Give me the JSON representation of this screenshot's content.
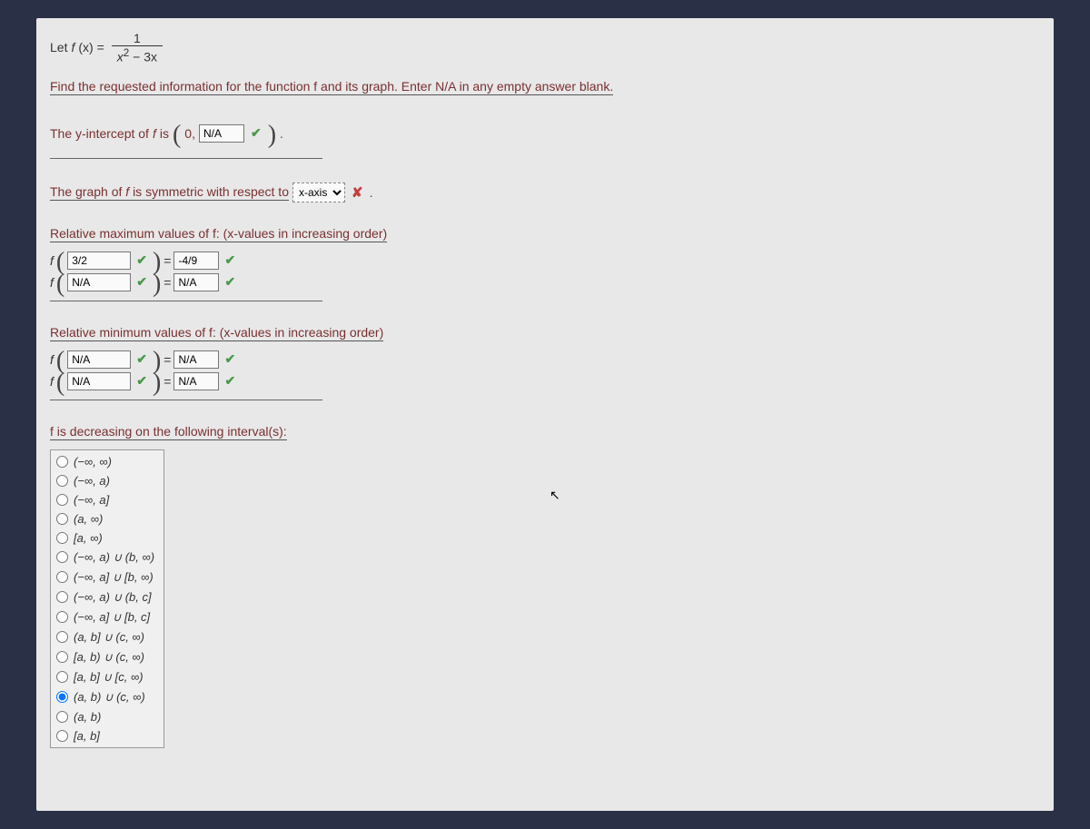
{
  "func": {
    "prefix": "Let ",
    "fname": "f",
    "arg": " (x) = ",
    "num": "1",
    "den_a": "x",
    "den_b": " − 3x",
    "den_sup": "2"
  },
  "instruction": "Find the requested information for the function f and its graph. Enter N/A in any empty answer blank.",
  "yint": {
    "pre": "The y-intercept of ",
    "f": "f",
    "mid": " is ",
    "zero": "0, ",
    "value": "N/A",
    "period": "."
  },
  "sym": {
    "pre": "The graph of ",
    "f": "f",
    "mid": " is symmetric with respect to ",
    "selected": "x-axis",
    "dot": "."
  },
  "relmax": {
    "heading": "Relative maximum values of f: (x-values in increasing order)",
    "r1_x": "3/2",
    "r1_y": "-4/9",
    "r2_x": "N/A",
    "r2_y": "N/A"
  },
  "relmin": {
    "heading": "Relative minimum values of f: (x-values in increasing order)",
    "r1_x": "N/A",
    "r1_y": "N/A",
    "r2_x": "N/A",
    "r2_y": "N/A"
  },
  "decreasing": {
    "heading": "f is decreasing on the following interval(s):",
    "options": [
      "(−∞, ∞)",
      "(−∞, a)",
      "(−∞, a]",
      "(a, ∞)",
      "[a, ∞)",
      "(−∞, a) ∪ (b, ∞)",
      "(−∞, a] ∪ [b, ∞)",
      "(−∞, a) ∪ (b, c]",
      "(−∞, a] ∪ [b, c]",
      "(a, b] ∪ (c, ∞)",
      "[a, b) ∪ (c, ∞)",
      "[a, b] ∪ [c, ∞)",
      "(a, b) ∪ (c, ∞)",
      "(a, b)",
      "[a, b]"
    ],
    "selected_index": 12
  },
  "labels": {
    "f": "f",
    "eq": " = "
  }
}
